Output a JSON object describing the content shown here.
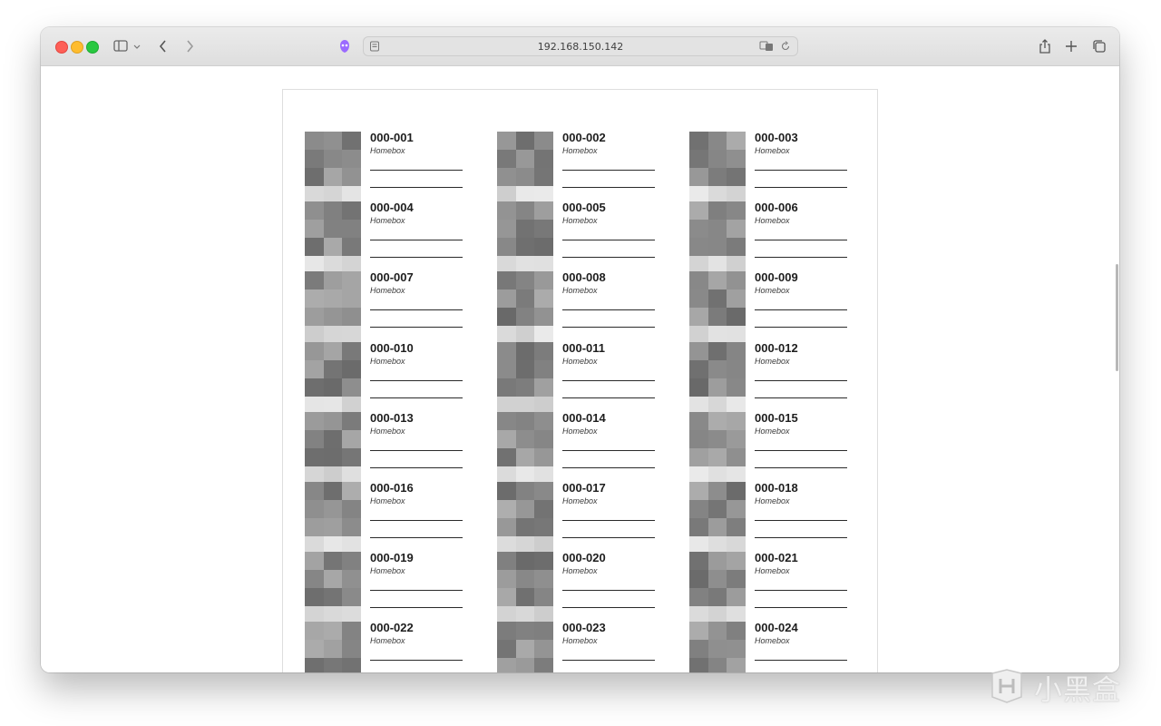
{
  "browser": {
    "address": "192.168.150.142",
    "buttons": [
      "sidebar-toggle",
      "back",
      "forward",
      "share",
      "new-tab",
      "tab-overview"
    ]
  },
  "labels": [
    {
      "id": "000-001",
      "location": "Homebox"
    },
    {
      "id": "000-002",
      "location": "Homebox"
    },
    {
      "id": "000-003",
      "location": "Homebox"
    },
    {
      "id": "000-004",
      "location": "Homebox"
    },
    {
      "id": "000-005",
      "location": "Homebox"
    },
    {
      "id": "000-006",
      "location": "Homebox"
    },
    {
      "id": "000-007",
      "location": "Homebox"
    },
    {
      "id": "000-008",
      "location": "Homebox"
    },
    {
      "id": "000-009",
      "location": "Homebox"
    },
    {
      "id": "000-010",
      "location": "Homebox"
    },
    {
      "id": "000-011",
      "location": "Homebox"
    },
    {
      "id": "000-012",
      "location": "Homebox"
    },
    {
      "id": "000-013",
      "location": "Homebox"
    },
    {
      "id": "000-014",
      "location": "Homebox"
    },
    {
      "id": "000-015",
      "location": "Homebox"
    },
    {
      "id": "000-016",
      "location": "Homebox"
    },
    {
      "id": "000-017",
      "location": "Homebox"
    },
    {
      "id": "000-018",
      "location": "Homebox"
    },
    {
      "id": "000-019",
      "location": "Homebox"
    },
    {
      "id": "000-020",
      "location": "Homebox"
    },
    {
      "id": "000-021",
      "location": "Homebox"
    },
    {
      "id": "000-022",
      "location": "Homebox"
    },
    {
      "id": "000-023",
      "location": "Homebox"
    },
    {
      "id": "000-024",
      "location": "Homebox"
    }
  ],
  "watermark": {
    "text": "小黑盒"
  },
  "colors": {
    "accent_extension": "#9b6bff"
  }
}
